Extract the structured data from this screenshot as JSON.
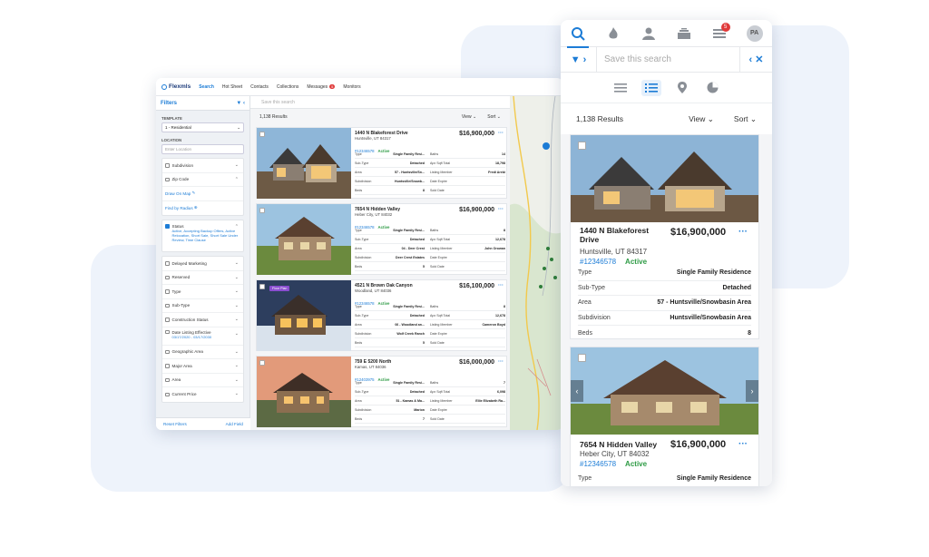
{
  "desktop": {
    "logo": "Flexmls",
    "nav": [
      "Search",
      "Hot Sheet",
      "Contacts",
      "Collections",
      "Messages",
      "Monitors"
    ],
    "messages_badge": "5",
    "filters": {
      "title": "Filters",
      "template_label": "TEMPLATE",
      "template_value": "1 - Residential",
      "location_label": "LOCATION",
      "location_placeholder": "Enter Location",
      "group1": [
        "Subdivision",
        "Zip Code",
        "Draw On Map",
        "Find by Radius"
      ],
      "status_label": "Status",
      "status_value": "Active, Accepting Backup Offers, Active Relocation, Short Sale, Short Sale Under Review, Time Clause",
      "group3": [
        "Delayed Marketing",
        "Reserved",
        "Type",
        "Sub-Type",
        "Construction Status",
        "Date Listing Effective",
        "Geographic Area",
        "Major Area",
        "Area",
        "Current Price"
      ],
      "date_range": "03/17/2020 - 03/17/2030",
      "reset": "Reset Filters",
      "add": "Add Field"
    },
    "search_placeholder": "Save this search",
    "result_count": "1,138 Results",
    "view": "View",
    "sort": "Sort",
    "listings": [
      {
        "addr": "1440 N Blakeforest Drive",
        "city": "Huntsville, UT 84317",
        "mls": "#12346578",
        "status": "Active",
        "price": "$16,900,000",
        "rows": [
          [
            "Type",
            "Single Family Resi...",
            "Baths",
            "14"
          ],
          [
            "Sub-Type",
            "Detached",
            "Apx Sqft Total",
            "18,798"
          ],
          [
            "Area",
            "57 - Huntsville/Sn...",
            "Listing Member",
            "Fredi Arebi"
          ],
          [
            "Subdivision",
            "Huntsville/Snowb...",
            "Date Expire",
            ""
          ],
          [
            "Beds",
            "8",
            "Sold Date",
            ""
          ]
        ]
      },
      {
        "addr": "7654 N Hidden Valley",
        "city": "Heber City, UT 84032",
        "mls": "#12346578",
        "status": "Active",
        "price": "$16,900,000",
        "rows": [
          [
            "Type",
            "Single Family Resi...",
            "Baths",
            "8"
          ],
          [
            "Sub-Type",
            "Detached",
            "Apx Sqft Total",
            "12,678"
          ],
          [
            "Area",
            "04 - Deer Crest",
            "Listing Member",
            "John Orowan"
          ],
          [
            "Subdivision",
            "Deer Crest Estates",
            "Date Expire",
            ""
          ],
          [
            "Beds",
            "5",
            "Sold Date",
            ""
          ]
        ]
      },
      {
        "addr": "4521 N Brown Oak Canyon",
        "city": "Woodland, UT 84036",
        "mls": "#12346578",
        "status": "Active",
        "price": "$16,100,000",
        "floor": "Floor Plan",
        "rows": [
          [
            "Type",
            "Single Family Resi...",
            "Baths",
            "8"
          ],
          [
            "Sub-Type",
            "Detached",
            "Apx Sqft Total",
            "12,678"
          ],
          [
            "Area",
            "06 - Woodland an...",
            "Listing Member",
            "Cameron Boyd"
          ],
          [
            "Subdivision",
            "Wolf Creek Ranch",
            "Date Expire",
            ""
          ],
          [
            "Beds",
            "5",
            "Sold Date",
            ""
          ]
        ]
      },
      {
        "addr": "759 E 5200 North",
        "city": "Kamas, UT 84036",
        "mls": "#12403975",
        "status": "Active",
        "price": "$16,000,000",
        "rows": [
          [
            "Type",
            "Single Family Resi...",
            "Baths",
            "7"
          ],
          [
            "Sub-Type",
            "Detached",
            "Apx Sqft Total",
            "6,098"
          ],
          [
            "Area",
            "51 - Kamas & Ma...",
            "Listing Member",
            "Ellie Elizabeth Ra..."
          ],
          [
            "Subdivision",
            "Marion",
            "Date Expire",
            ""
          ],
          [
            "Beds",
            "7",
            "Sold Date",
            ""
          ]
        ]
      }
    ]
  },
  "mobile": {
    "nav_badge": "5",
    "avatar": "PA",
    "search_placeholder": "Save this search",
    "result_count": "1,138 Results",
    "view": "View",
    "sort": "Sort",
    "listings": [
      {
        "addr": "1440 N Blakeforest Drive",
        "city": "Huntsville, UT 84317",
        "mls": "#12346578",
        "status": "Active",
        "price": "$16,900,000",
        "rows": [
          [
            "Type",
            "Single Family Residence"
          ],
          [
            "Sub-Type",
            "Detached"
          ],
          [
            "Area",
            "57 - Huntsville/Snowbasin Area"
          ],
          [
            "Subdivision",
            "Huntsville/Snowbasin Area"
          ],
          [
            "Beds",
            "8"
          ]
        ]
      },
      {
        "addr": "7654 N Hidden Valley",
        "city": "Heber City, UT 84032",
        "mls": "#12346578",
        "status": "Active",
        "price": "$16,900,000",
        "rows": [
          [
            "Type",
            "Single Family Residence"
          ]
        ]
      }
    ]
  },
  "colors": {
    "accent": "#1c7cd6",
    "active": "#2e9b45",
    "badge": "#e03a3a"
  }
}
